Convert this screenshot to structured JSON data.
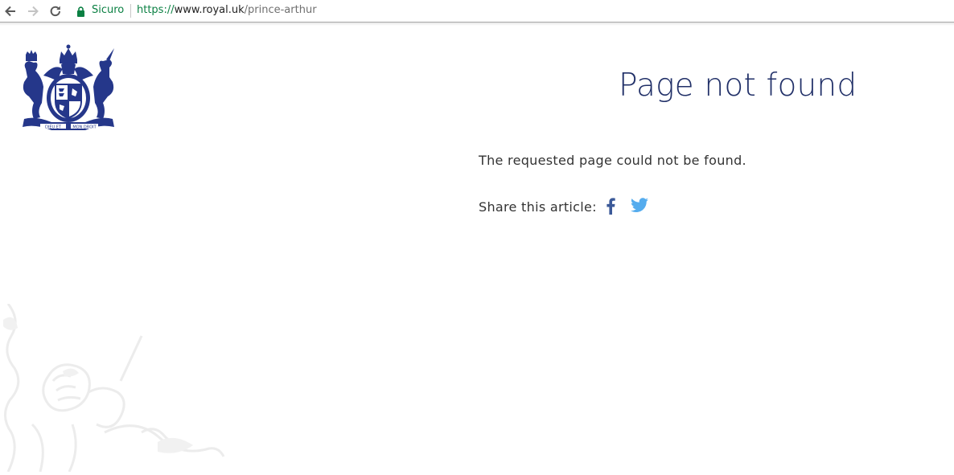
{
  "browser": {
    "security_label": "Sicuro",
    "url_scheme": "https://",
    "url_host": "www.royal.uk",
    "url_path": "/prince-arthur"
  },
  "crest": {
    "motto_left": "DIEU ET",
    "motto_right": "MON DROIT"
  },
  "page": {
    "title": "Page not found",
    "message": "The requested page could not be found.",
    "share_label": "Share this article:"
  },
  "icons": {
    "back": "back-arrow-icon",
    "forward": "forward-arrow-icon",
    "reload": "reload-icon",
    "lock": "lock-icon",
    "facebook": "facebook-icon",
    "twitter": "twitter-icon"
  },
  "colors": {
    "title": "#213068",
    "crest": "#25378a",
    "secure": "#0b8043",
    "facebook": "#3b5998",
    "twitter": "#55acee"
  }
}
